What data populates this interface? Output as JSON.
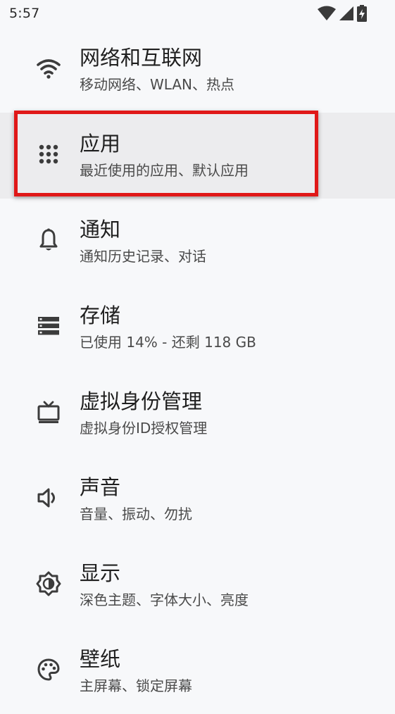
{
  "status_bar": {
    "time": "5:57",
    "icons": [
      "wifi-signal-icon",
      "cell-signal-icon",
      "battery-charging-icon"
    ]
  },
  "colors": {
    "highlight": "#e01818",
    "selected_row": "#ececee",
    "background": "#f7f8fa"
  },
  "settings": {
    "items": [
      {
        "icon": "wifi-icon",
        "title": "网络和互联网",
        "subtitle": "移动网络、WLAN、热点"
      },
      {
        "icon": "apps-grid-icon",
        "title": "应用",
        "subtitle": "最近使用的应用、默认应用"
      },
      {
        "icon": "bell-icon",
        "title": "通知",
        "subtitle": "通知历史记录、对话"
      },
      {
        "icon": "storage-icon",
        "title": "存储",
        "subtitle": "已使用 14% - 还剩 118 GB"
      },
      {
        "icon": "tv-icon",
        "title": "虚拟身份管理",
        "subtitle": "虚拟身份ID授权管理"
      },
      {
        "icon": "speaker-icon",
        "title": "声音",
        "subtitle": "音量、振动、勿扰"
      },
      {
        "icon": "brightness-icon",
        "title": "显示",
        "subtitle": "深色主题、字体大小、亮度"
      },
      {
        "icon": "palette-icon",
        "title": "壁纸",
        "subtitle": "主屏幕、锁定屏幕"
      }
    ]
  }
}
